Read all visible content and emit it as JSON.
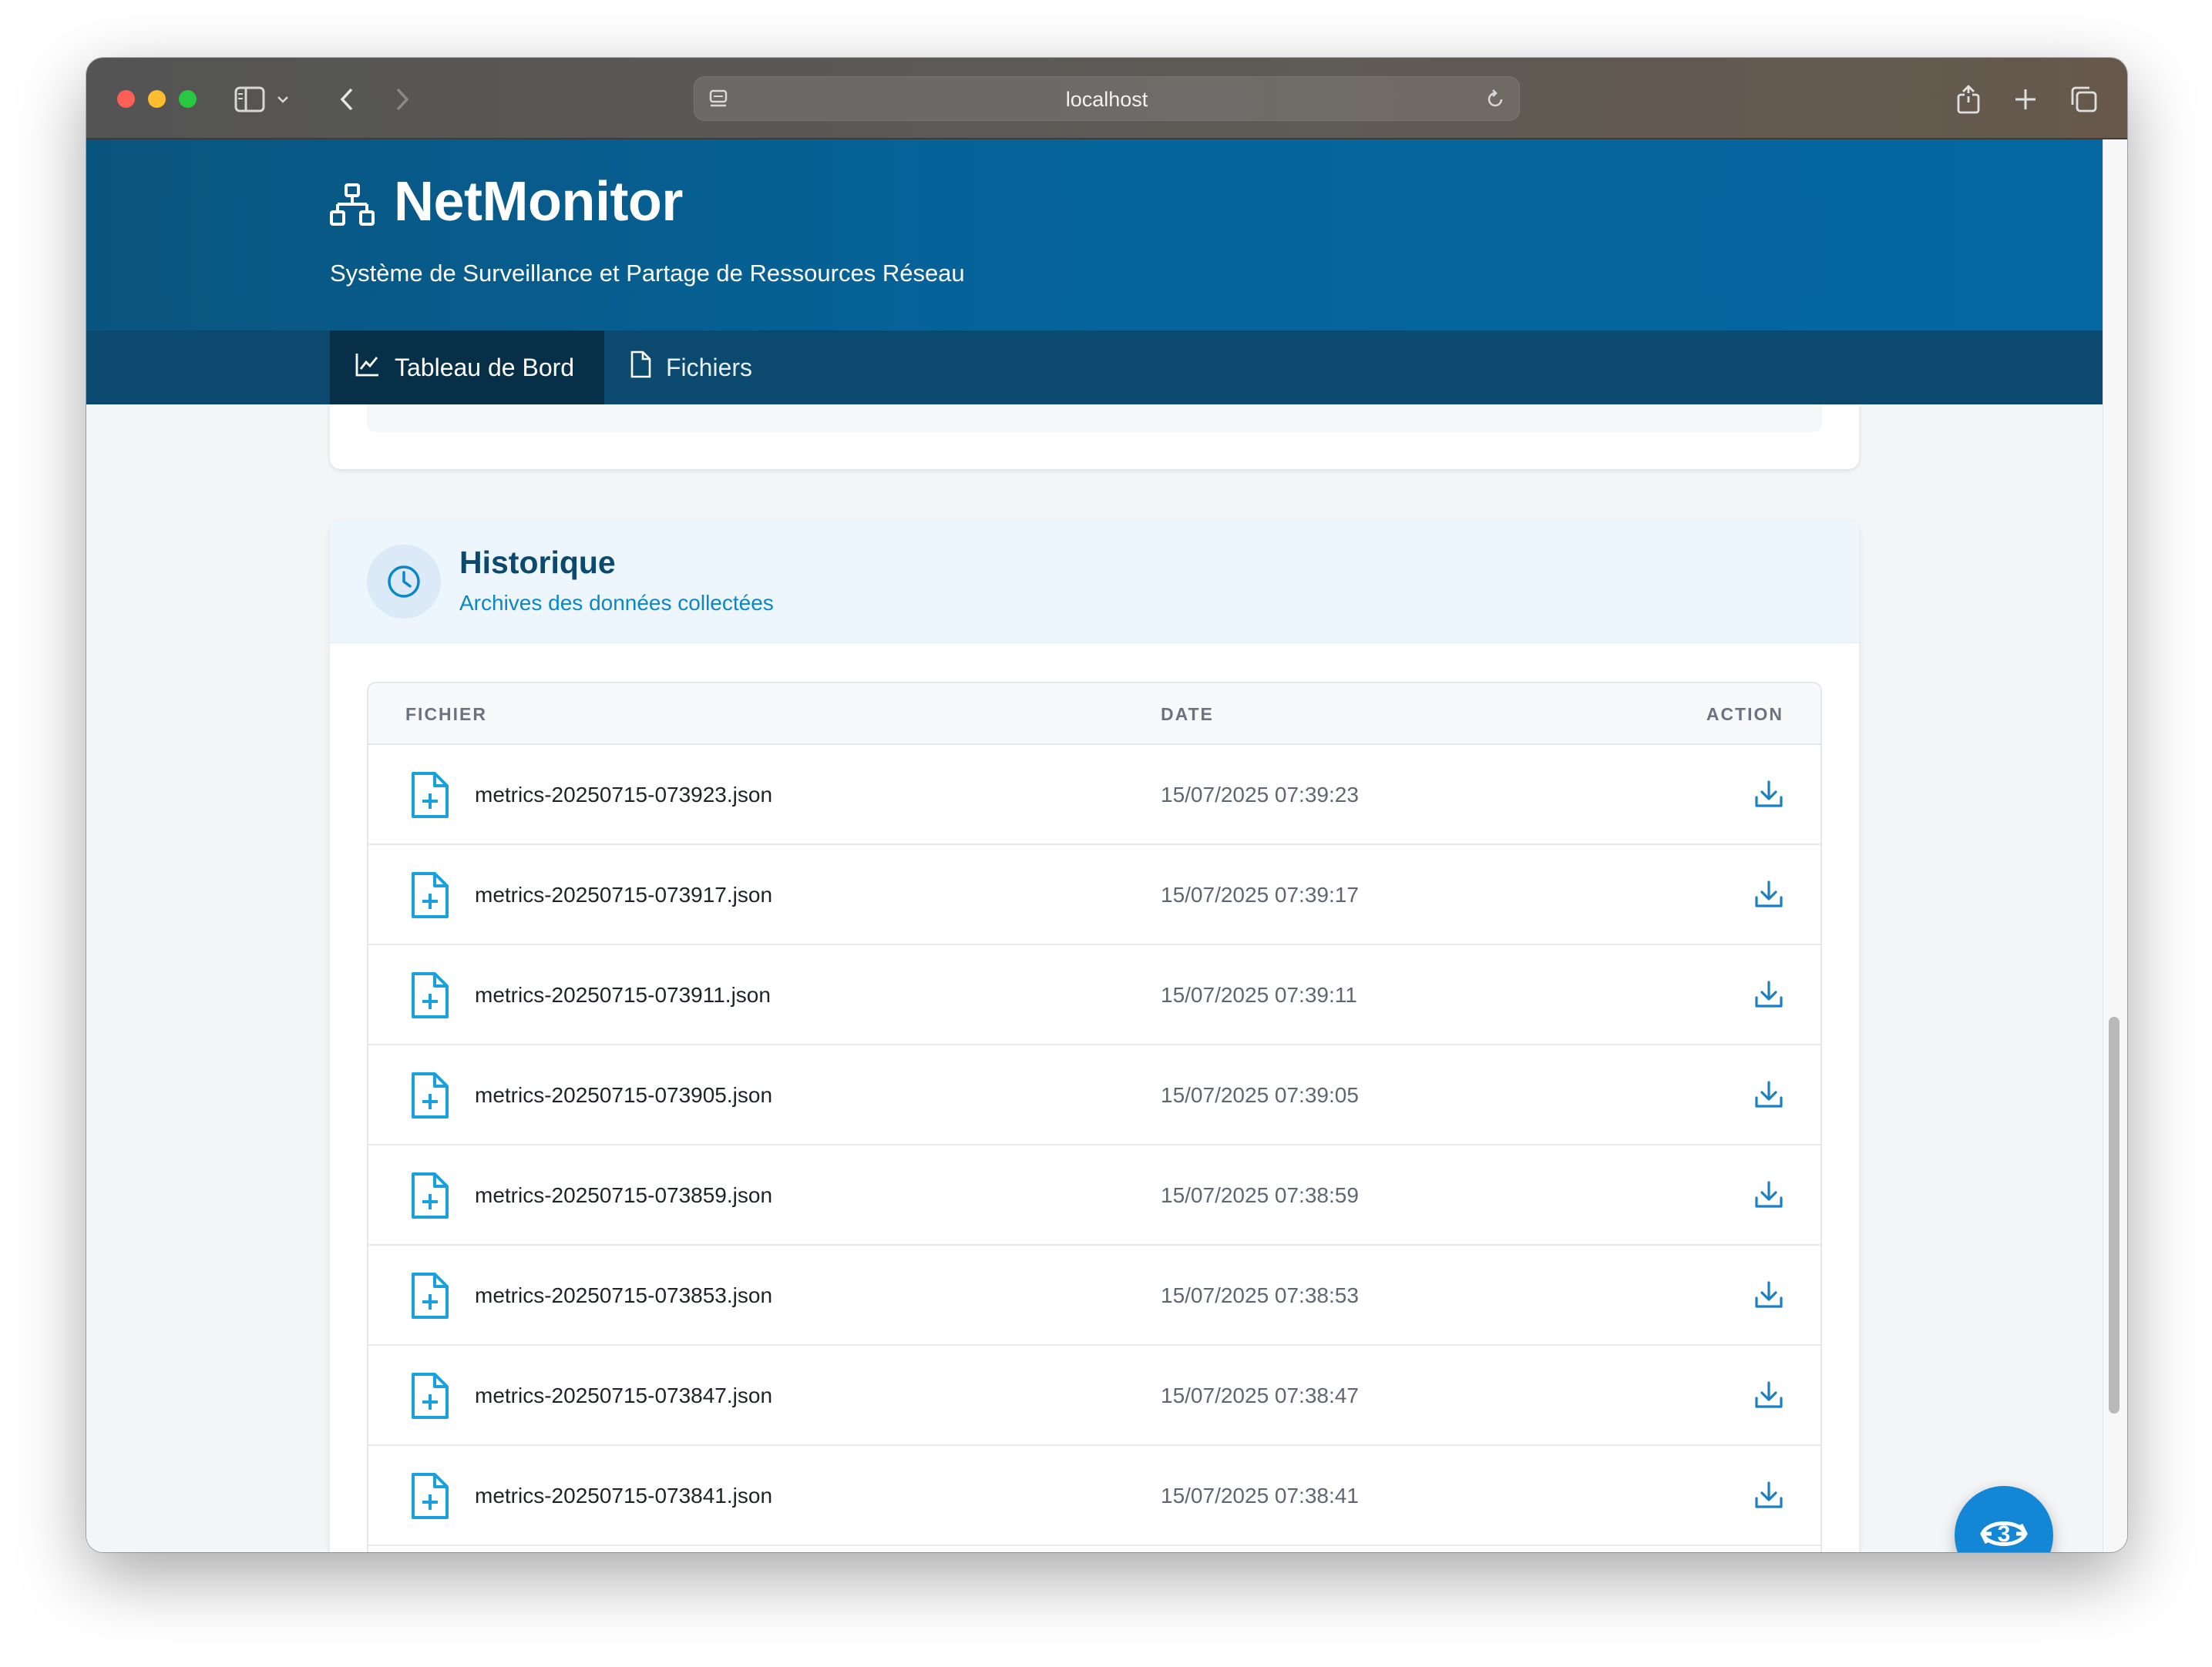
{
  "browser": {
    "address": "localhost"
  },
  "app": {
    "title": "NetMonitor",
    "subtitle": "Système de Surveillance et Partage de Ressources Réseau",
    "icon": "network-icon"
  },
  "nav": {
    "tabs": [
      {
        "label": "Tableau de Bord",
        "icon": "chart-line-icon",
        "active": true
      },
      {
        "label": "Fichiers",
        "icon": "file-icon",
        "active": false
      }
    ]
  },
  "history": {
    "title": "Historique",
    "subtitle": "Archives des données collectées",
    "icon": "clock-icon",
    "columns": [
      "FICHIER",
      "DATE",
      "ACTION"
    ],
    "rows": [
      {
        "file": "metrics-20250715-073923.json",
        "date": "15/07/2025 07:39:23"
      },
      {
        "file": "metrics-20250715-073917.json",
        "date": "15/07/2025 07:39:17"
      },
      {
        "file": "metrics-20250715-073911.json",
        "date": "15/07/2025 07:39:11"
      },
      {
        "file": "metrics-20250715-073905.json",
        "date": "15/07/2025 07:39:05"
      },
      {
        "file": "metrics-20250715-073859.json",
        "date": "15/07/2025 07:38:59"
      },
      {
        "file": "metrics-20250715-073853.json",
        "date": "15/07/2025 07:38:53"
      },
      {
        "file": "metrics-20250715-073847.json",
        "date": "15/07/2025 07:38:47"
      },
      {
        "file": "metrics-20250715-073841.json",
        "date": "15/07/2025 07:38:41"
      }
    ]
  },
  "fab": {
    "label": "3",
    "icon": "refresh-icon"
  },
  "colors": {
    "header": "#05639a",
    "navbar": "#0b4a6e",
    "accent": "#1386d6",
    "file_icon": "#1aa0dd"
  }
}
